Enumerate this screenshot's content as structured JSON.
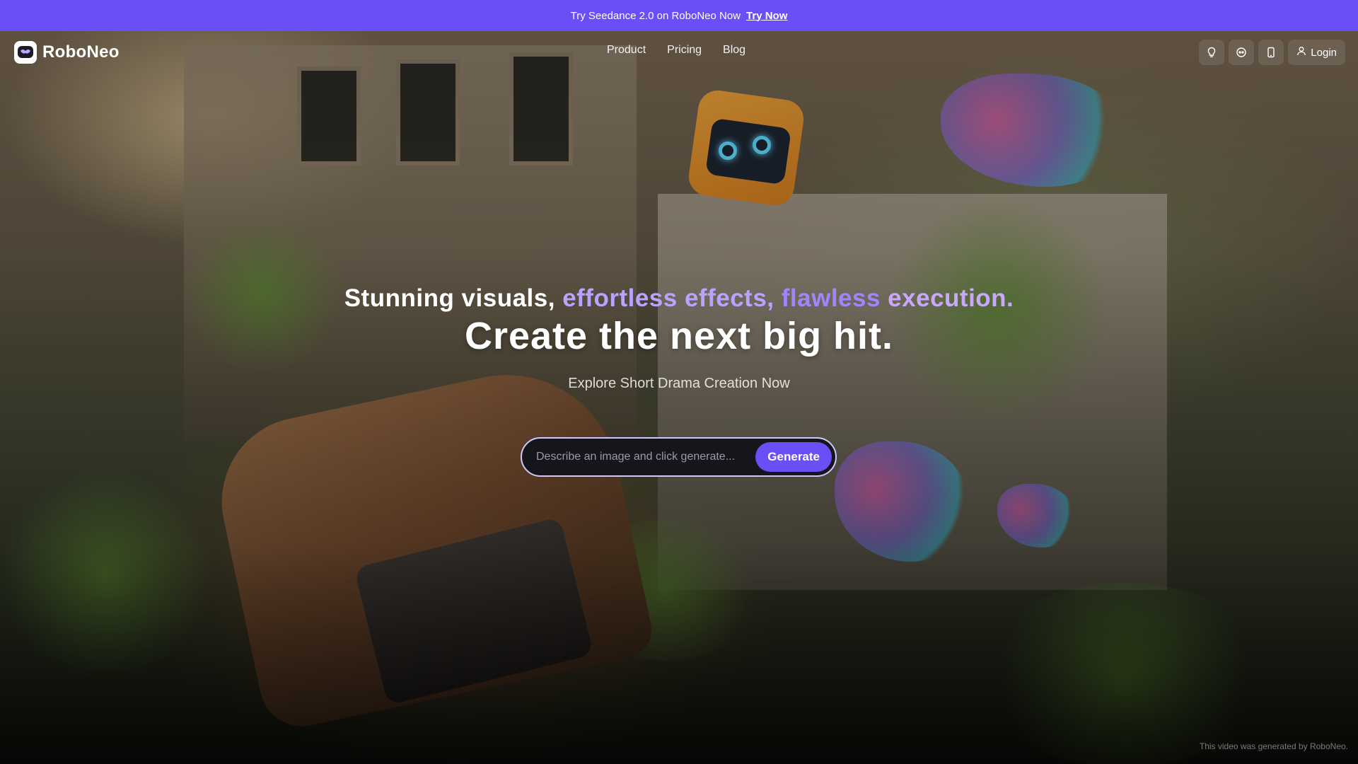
{
  "banner": {
    "text": "Try Seedance 2.0 on RoboNeo Now",
    "link": "Try Now"
  },
  "nav": {
    "brand": "RoboNeo",
    "links": [
      "Product",
      "Pricing",
      "Blog"
    ],
    "login": "Login",
    "icons": [
      "lightbulb-icon",
      "discord-icon",
      "mobile-icon"
    ]
  },
  "hero": {
    "tagline_1": "Stunning visuals, ",
    "tagline_2": "effortless effects, ",
    "tagline_3": "flawless ",
    "tagline_4": "execution.",
    "headline": "Create the next big hit.",
    "subline": "Explore Short Drama Creation Now",
    "prompt_placeholder": "Describe an image and click generate...",
    "prompt_value": "",
    "generate_label": "Generate",
    "credit": "This video was generated by RoboNeo."
  },
  "colors": {
    "accent": "#6b4ef6",
    "tagline_purple": "#9f86ff"
  }
}
